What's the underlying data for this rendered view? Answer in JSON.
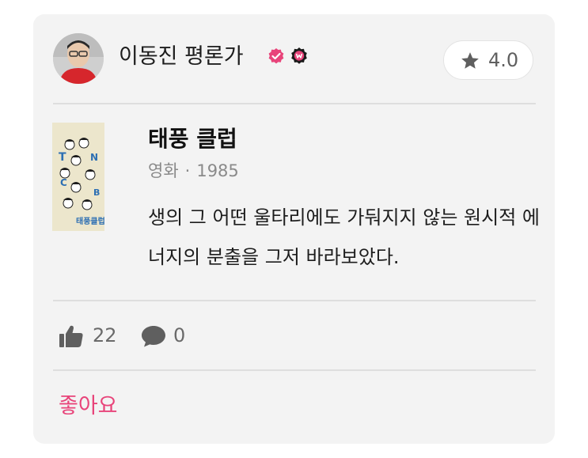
{
  "author": {
    "name": "이동진 평론가"
  },
  "rating": {
    "value": "4.0",
    "icon": "star-icon"
  },
  "movie": {
    "title": "태풍 클럽",
    "category": "영화",
    "separator": "·",
    "year": "1985",
    "poster_text": "태풍클럽"
  },
  "review": {
    "text": "생의 그 어떤 울타리에도 가둬지지 않는 원시적 에너지의 분출을 그저 바라보았다."
  },
  "stats": {
    "likes": "22",
    "comments": "0"
  },
  "actions": {
    "like_label": "좋아요"
  },
  "colors": {
    "accent": "#e8447a",
    "card_bg": "#f3f3f3"
  }
}
